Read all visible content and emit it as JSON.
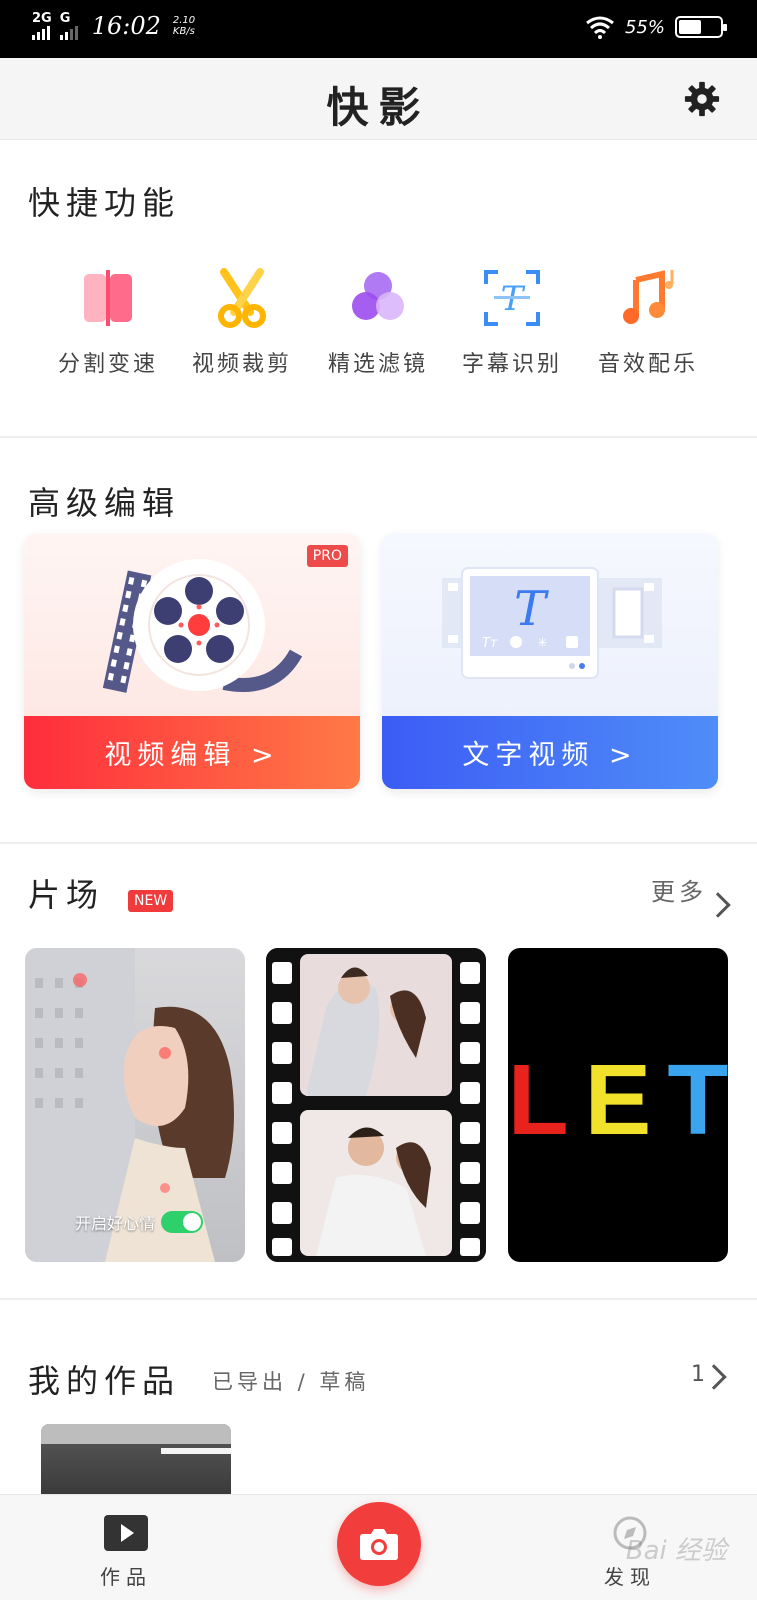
{
  "status_bar": {
    "network1": "2G",
    "network2": "G",
    "time": "16:02",
    "speed_value": "2.10",
    "speed_unit": "KB/s",
    "battery": "55%",
    "battery_level": 0.55
  },
  "header": {
    "title": "快影",
    "settings_icon": "gear-icon"
  },
  "quick_functions": {
    "title": "快捷功能",
    "items": [
      {
        "label": "分割变速",
        "icon": "split-speed-icon",
        "color": "#ff6b8a"
      },
      {
        "label": "视频裁剪",
        "icon": "scissors-icon",
        "color": "#ffc21a"
      },
      {
        "label": "精选滤镜",
        "icon": "filter-circles-icon",
        "color": "#a65cf0"
      },
      {
        "label": "字幕识别",
        "icon": "subtitle-recognize-icon",
        "color": "#3b8cf5"
      },
      {
        "label": "音效配乐",
        "icon": "music-note-icon",
        "color": "#ff7a2f"
      }
    ]
  },
  "advanced_edit": {
    "title": "高级编辑",
    "cards": [
      {
        "label": "视频编辑 >",
        "badge": "PRO",
        "icon": "film-reel-icon",
        "color_from": "#ff2d3c",
        "color_to": "#ff7a46"
      },
      {
        "label": "文字视频 >",
        "art_letter": "T",
        "icon": "text-video-icon",
        "color_from": "#3c5cf5",
        "color_to": "#4f8df8"
      }
    ]
  },
  "studio": {
    "title": "片场",
    "badge": "NEW",
    "more_label": "更多",
    "thumbs": [
      {
        "caption": "开启好心情",
        "name": "thumb-good-mood"
      },
      {
        "caption": "",
        "name": "thumb-film-strip-couple"
      },
      {
        "caption": "",
        "name": "thumb-let"
      }
    ],
    "let_letters": [
      {
        "char": "L",
        "color": "#e8221c"
      },
      {
        "char": "E",
        "color": "#f2e12a"
      },
      {
        "char": "T",
        "color": "#3aa4ee"
      }
    ]
  },
  "my_works": {
    "title": "我的作品",
    "subtitle": "已导出 / 草稿",
    "count": "1"
  },
  "tabbar": {
    "works_label": "作品",
    "discover_label": "发现",
    "camera_icon": "camera-icon",
    "watermark": "Bai 经验"
  }
}
